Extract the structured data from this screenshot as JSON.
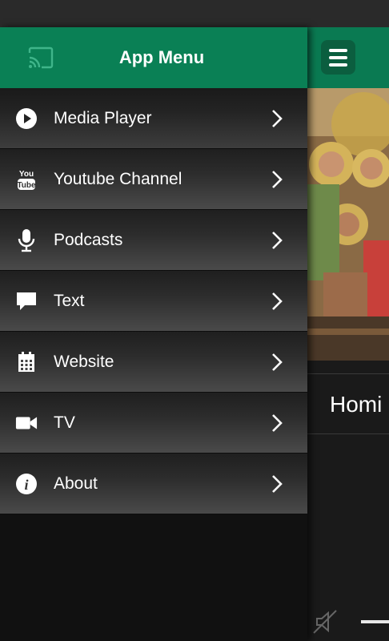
{
  "drawer": {
    "title": "App Menu",
    "items": [
      {
        "label": "Media Player",
        "icon": "play-circle-icon"
      },
      {
        "label": "Youtube Channel",
        "icon": "youtube-icon"
      },
      {
        "label": "Podcasts",
        "icon": "microphone-icon"
      },
      {
        "label": "Text",
        "icon": "speech-bubble-icon"
      },
      {
        "label": "Website",
        "icon": "calendar-icon"
      },
      {
        "label": "TV",
        "icon": "video-camera-icon"
      },
      {
        "label": "About",
        "icon": "info-icon"
      }
    ]
  },
  "background_screen": {
    "item_title": "Homi"
  },
  "colors": {
    "accent": "#0a8055",
    "menu_button": "#0b5e3f"
  }
}
